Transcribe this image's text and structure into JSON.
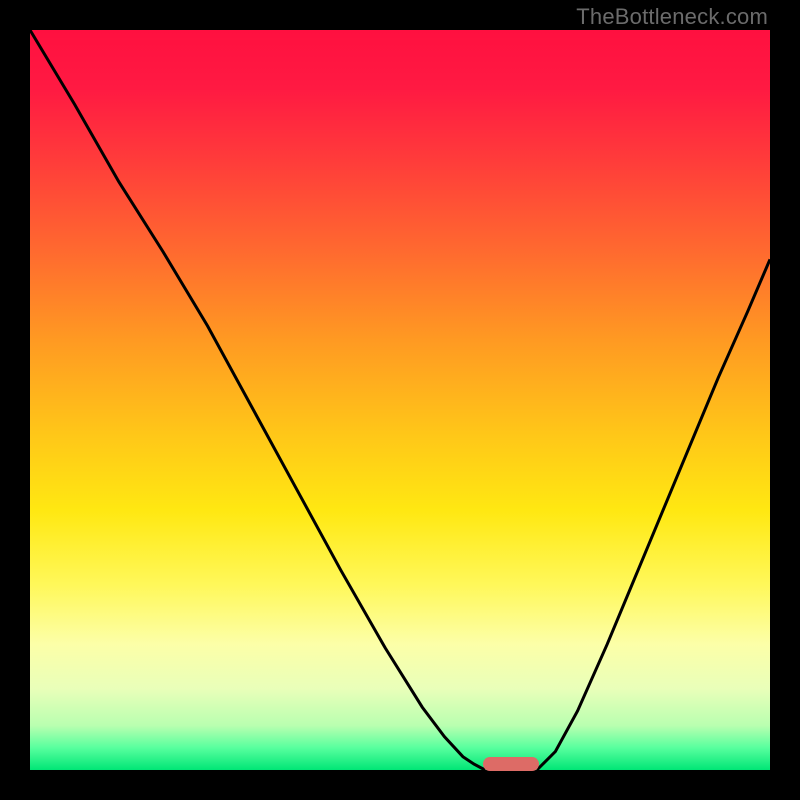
{
  "watermark": "TheBottleneck.com",
  "colors": {
    "marker": "#dd6b66",
    "curve": "#000000",
    "frame_bg": "#000000"
  },
  "chart_data": {
    "type": "line",
    "title": "",
    "xlabel": "",
    "ylabel": "",
    "xlim": [
      0,
      1
    ],
    "ylim": [
      0,
      1
    ],
    "series": [
      {
        "name": "left-curve",
        "x": [
          0.0,
          0.06,
          0.12,
          0.18,
          0.24,
          0.3,
          0.36,
          0.42,
          0.48,
          0.53,
          0.56,
          0.585,
          0.6,
          0.615
        ],
        "y": [
          1.0,
          0.9,
          0.795,
          0.7,
          0.6,
          0.49,
          0.38,
          0.27,
          0.165,
          0.085,
          0.045,
          0.018,
          0.008,
          0.0
        ]
      },
      {
        "name": "right-curve",
        "x": [
          0.685,
          0.71,
          0.74,
          0.78,
          0.83,
          0.88,
          0.93,
          0.97,
          1.0
        ],
        "y": [
          0.0,
          0.025,
          0.08,
          0.17,
          0.29,
          0.41,
          0.53,
          0.62,
          0.69
        ]
      }
    ],
    "marker": {
      "x_center": 0.65,
      "width": 0.075,
      "y": 0.0
    },
    "gradient_stops": [
      {
        "pos": 0.0,
        "color": "#ff1040"
      },
      {
        "pos": 0.5,
        "color": "#ffd400"
      },
      {
        "pos": 0.85,
        "color": "#fdff9e"
      },
      {
        "pos": 1.0,
        "color": "#00e676"
      }
    ]
  }
}
